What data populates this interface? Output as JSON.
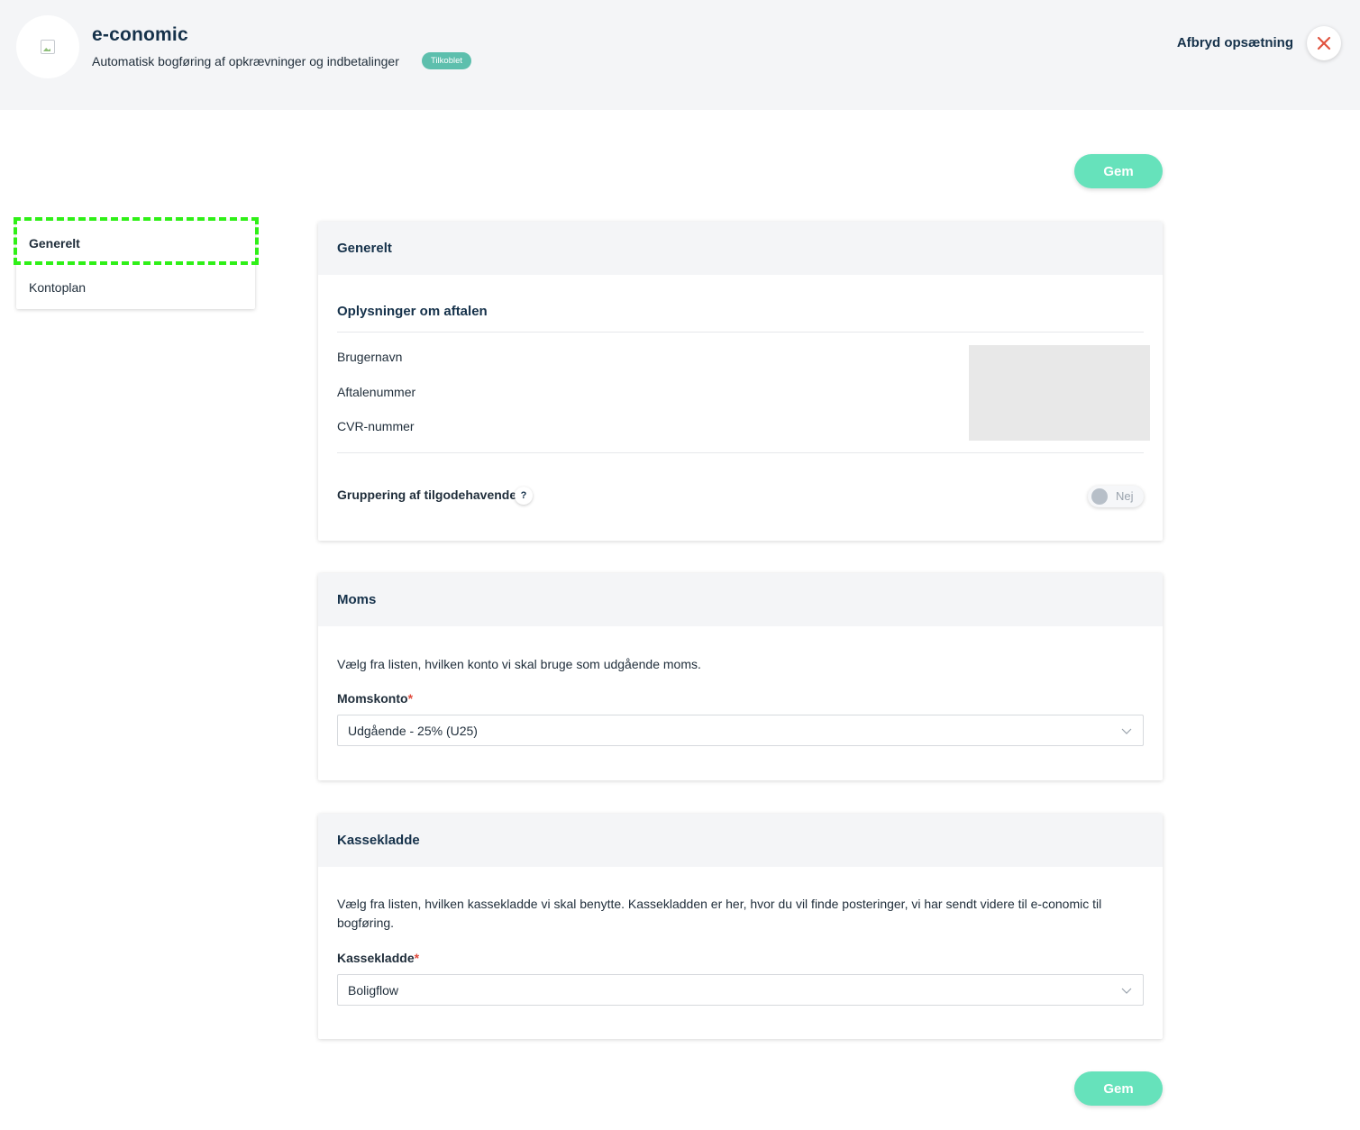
{
  "header": {
    "title": "e-conomic",
    "subtitle": "Automatisk bogføring af opkrævninger og indbetalinger",
    "status_badge": "Tilkoblet",
    "cancel_label": "Afbryd opsætning",
    "close_color": "#e0533f"
  },
  "actions": {
    "save_label": "Gem"
  },
  "sidebar": {
    "items": [
      {
        "label": "Generelt",
        "active": true
      },
      {
        "label": "Kontoplan",
        "active": false
      }
    ]
  },
  "general": {
    "header": "Generelt",
    "section_title": "Oplysninger om aftalen",
    "fields": [
      "Brugernavn",
      "Aftalenummer",
      "CVR-nummer"
    ],
    "grouping_label": "Gruppering af tilgodehavende",
    "help_icon": "?",
    "toggle_value": "Nej"
  },
  "vat": {
    "header": "Moms",
    "description": "Vælg fra listen, hvilken konto vi skal bruge som udgående moms.",
    "field_label": "Momskonto",
    "required_marker": "*",
    "selected": "Udgående - 25% (U25)"
  },
  "cashbook": {
    "header": "Kassekladde",
    "description": "Vælg fra listen, hvilken kassekladde vi skal benytte. Kassekladden er her, hvor du vil finde posteringer, vi har sendt videre til e-conomic til bogføring.",
    "field_label": "Kassekladde",
    "required_marker": "*",
    "selected": "Boligflow"
  },
  "colors": {
    "accent": "#66e2bb",
    "badge": "#5dbfad",
    "highlight": "#2ff017"
  }
}
